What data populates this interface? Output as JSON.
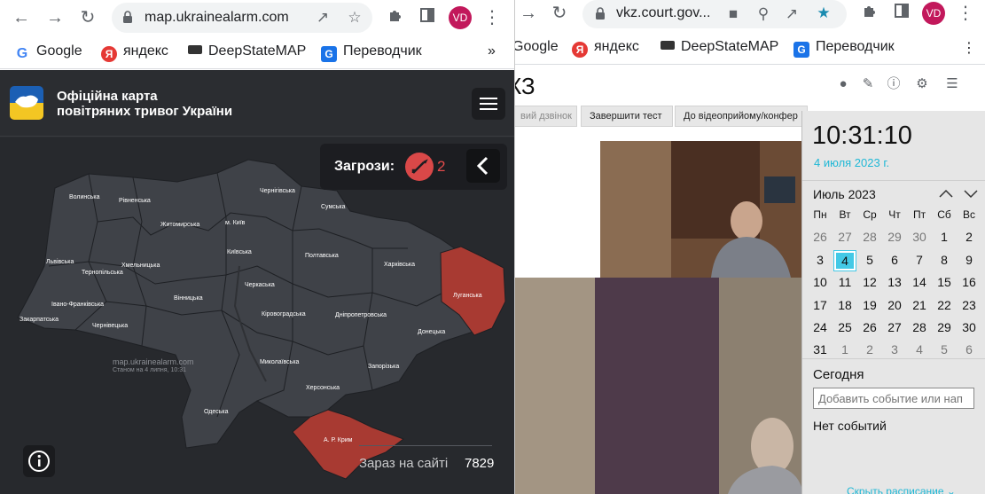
{
  "left_window": {
    "url": "map.ukrainealarm.com",
    "bookmarks": [
      {
        "label": "Google",
        "icon": "google-icon",
        "color": "#4285f4"
      },
      {
        "label": "яндекс",
        "icon": "yandex-icon",
        "color": "#e53935"
      },
      {
        "label": "DeepStateMAP",
        "icon": "deepstate-icon",
        "color": "#333333"
      },
      {
        "label": "Переводчик",
        "icon": "translate-icon",
        "color": "#1a73e8"
      }
    ],
    "bookmarks_more": "»",
    "avatar": "VD",
    "page": {
      "title_line1": "Офіційна карта",
      "title_line2": "повітряних тривог України",
      "threats": {
        "label": "Загрози:",
        "count": "2",
        "icon": "missile-icon"
      },
      "regions": [
        {
          "name": "Волинська"
        },
        {
          "name": "Рівненська"
        },
        {
          "name": "Житомирська"
        },
        {
          "name": "м. Київ"
        },
        {
          "name": "Чернігівська"
        },
        {
          "name": "Сумська"
        },
        {
          "name": "Львівська"
        },
        {
          "name": "Тернопільська"
        },
        {
          "name": "Хмельницька"
        },
        {
          "name": "Київська"
        },
        {
          "name": "Полтавська"
        },
        {
          "name": "Харківська"
        },
        {
          "name": "Луганська"
        },
        {
          "name": "Івано-Франківська"
        },
        {
          "name": "Закарпатська"
        },
        {
          "name": "Чернівецька"
        },
        {
          "name": "Вінницька"
        },
        {
          "name": "Черкаська"
        },
        {
          "name": "Кіровоградська"
        },
        {
          "name": "Дніпропетровська"
        },
        {
          "name": "Донецька"
        },
        {
          "name": "Миколаївська"
        },
        {
          "name": "Запорізька"
        },
        {
          "name": "Херсонська"
        },
        {
          "name": "Одеська"
        },
        {
          "name": "А. Р. Крим"
        }
      ],
      "alert_regions": [
        "Луганська",
        "А. Р. Крим"
      ],
      "alert_color": "#a83a32",
      "watermark_line1": "map.ukrainealarm.com",
      "watermark_line2": "Станом на 4 липня, 10:31",
      "online_label": "Зараз на сайті",
      "online_count": "7829"
    }
  },
  "right_window": {
    "url": "vkz.court.gov...",
    "avatar": "VD",
    "bookmarks": [
      {
        "label": "Google"
      },
      {
        "label": "яндекс"
      },
      {
        "label": "DeepStateMAP"
      },
      {
        "label": "Переводчик"
      }
    ],
    "court_title": "КЗ",
    "tabs": [
      {
        "label": "вий дзвінок"
      },
      {
        "label": "Завершити тест"
      },
      {
        "label": "До відеоприйому/конфер"
      }
    ]
  },
  "calendar": {
    "time": "10:31:10",
    "date": "4 июля 2023 г.",
    "month": "Июль 2023",
    "weekdays": [
      "Пн",
      "Вт",
      "Ср",
      "Чт",
      "Пт",
      "Сб",
      "Вс"
    ],
    "weeks": [
      [
        "26",
        "27",
        "28",
        "29",
        "30",
        "1",
        "2"
      ],
      [
        "3",
        "4",
        "5",
        "6",
        "7",
        "8",
        "9"
      ],
      [
        "10",
        "11",
        "12",
        "13",
        "14",
        "15",
        "16"
      ],
      [
        "17",
        "18",
        "19",
        "20",
        "21",
        "22",
        "23"
      ],
      [
        "24",
        "25",
        "26",
        "27",
        "28",
        "29",
        "30"
      ],
      [
        "31",
        "1",
        "2",
        "3",
        "4",
        "5",
        "6"
      ]
    ],
    "today": "4",
    "today_label": "Сегодня",
    "event_placeholder": "Добавить событие или нап",
    "no_events": "Нет событий",
    "hide_schedule": "Скрыть расписание"
  }
}
